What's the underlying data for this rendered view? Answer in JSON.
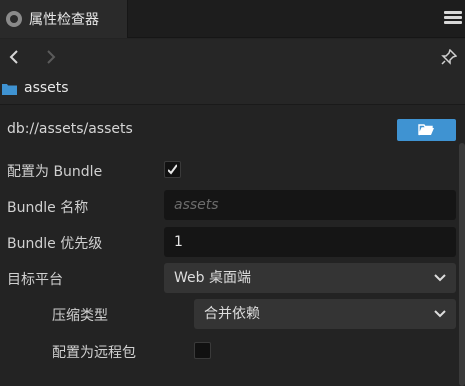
{
  "window": {
    "tab_title": "属性检查器"
  },
  "header": {
    "asset_name": "assets"
  },
  "inspector": {
    "path": "db://assets/assets",
    "bundle_config": {
      "label": "配置为 Bundle",
      "checked": true
    },
    "bundle_name": {
      "label": "Bundle 名称",
      "placeholder": "assets"
    },
    "bundle_priority": {
      "label": "Bundle 优先级",
      "value": "1"
    },
    "target_platform": {
      "label": "目标平台",
      "selected": "Web 桌面端"
    },
    "compression_type": {
      "label": "压缩类型",
      "selected": "合并依赖"
    },
    "remote_bundle": {
      "label": "配置为远程包",
      "checked": false
    }
  },
  "colors": {
    "accent_button": "#3f93d2",
    "folder_icon": "#3f93d2"
  }
}
